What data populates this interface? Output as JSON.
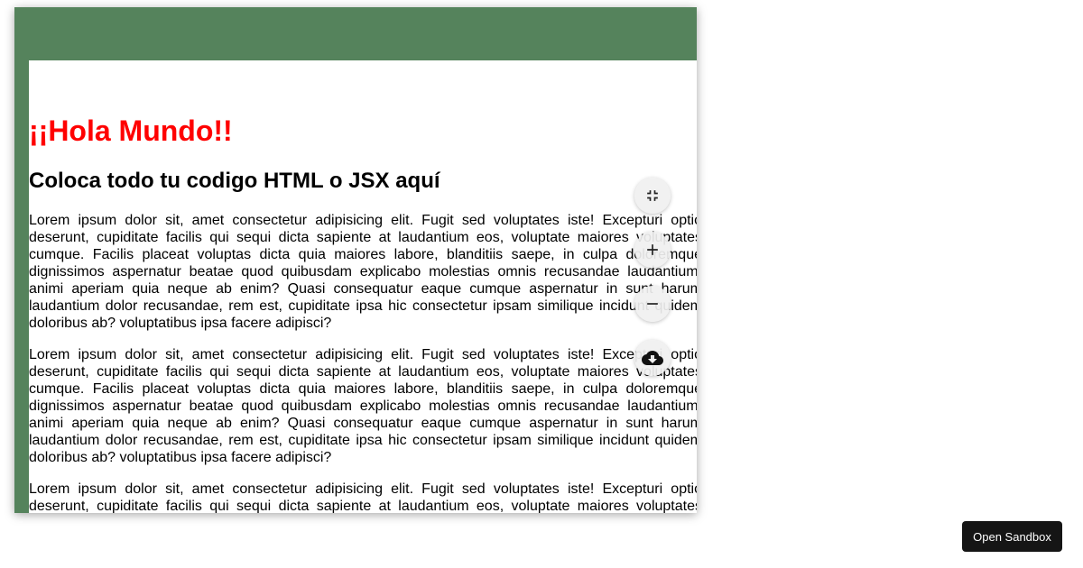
{
  "preview": {
    "heading": "¡¡Hola Mundo!!",
    "subheading": "Coloca todo tu codigo HTML o JSX aquí",
    "paragraphs": [
      "Lorem ipsum dolor sit, amet consectetur adipisicing elit. Fugit sed voluptates iste! Excepturi optio deserunt, cupiditate facilis qui sequi dicta sapiente at laudantium eos, voluptate maiores voluptates cumque. Facilis placeat voluptas dicta quia maiores labore, blanditiis saepe, in culpa doloremque dignissimos aspernatur beatae quod quibusdam explicabo molestias omnis recusandae laudantium, animi aperiam quia neque ab enim? Quasi consequatur eaque cumque aspernatur in sunt harum laudantium dolor recusandae, rem est, cupiditate ipsa hic consectetur ipsam similique incidunt quidem doloribus ab? voluptatibus ipsa facere adipisci?",
      "Lorem ipsum dolor sit, amet consectetur adipisicing elit. Fugit sed voluptates iste! Excepturi optio deserunt, cupiditate facilis qui sequi dicta sapiente at laudantium eos, voluptate maiores voluptates cumque. Facilis placeat voluptas dicta quia maiores labore, blanditiis saepe, in culpa doloremque dignissimos aspernatur beatae quod quibusdam explicabo molestias omnis recusandae laudantium, animi aperiam quia neque ab enim? Quasi consequatur eaque cumque aspernatur in sunt harum laudantium dolor recusandae, rem est, cupiditate ipsa hic consectetur ipsam similique incidunt quidem doloribus ab? voluptatibus ipsa facere adipisci?",
      "Lorem ipsum dolor sit, amet consectetur adipisicing elit. Fugit sed voluptates iste! Excepturi optio deserunt, cupiditate facilis qui sequi dicta sapiente at laudantium eos, voluptate maiores voluptates cumque."
    ]
  },
  "controls": {
    "icons": [
      "fullscreen-exit-icon",
      "zoom-in-icon",
      "zoom-out-icon",
      "cloud-download-icon"
    ]
  },
  "footer": {
    "open_sandbox_label": "Open Sandbox"
  },
  "colors": {
    "frame_background": "#55835c",
    "heading": "#ff0000"
  }
}
